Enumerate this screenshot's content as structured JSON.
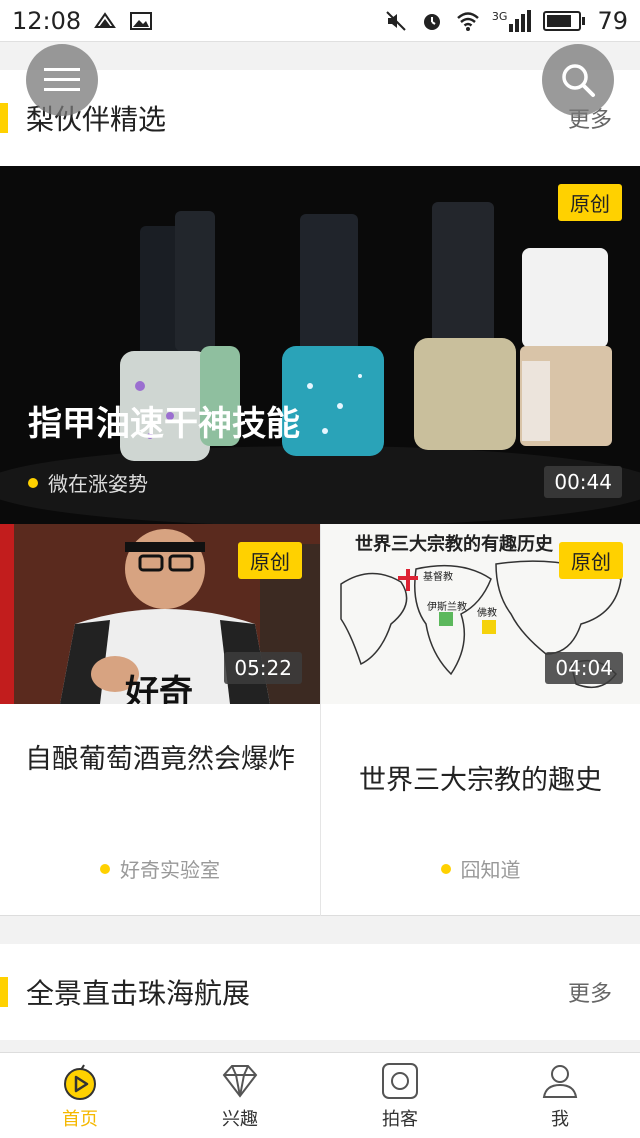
{
  "status_bar": {
    "time": "12:08",
    "network": "3G",
    "battery": "79"
  },
  "header": {
    "menu_icon": "hamburger-icon",
    "search_icon": "search-icon"
  },
  "section1": {
    "title": "梨伙伴精选",
    "more": "更多"
  },
  "feature": {
    "badge": "原创",
    "title": "指甲油速干神技能",
    "author": "微在涨姿势",
    "duration": "00:44"
  },
  "cards": [
    {
      "badge": "原创",
      "duration": "05:22",
      "title": "自酿葡萄酒竟然会爆炸",
      "author": "好奇实验室"
    },
    {
      "badge": "原创",
      "duration": "04:04",
      "title": "世界三大宗教的趣史",
      "author": "囧知道",
      "thumb_text": {
        "heading": "世界三大宗教的有趣历史",
        "label1": "基督教",
        "label2": "伊斯兰教",
        "label3": "佛教"
      }
    }
  ],
  "section2": {
    "title": "全景直击珠海航展",
    "more": "更多"
  },
  "bottom_nav": {
    "items": [
      {
        "label": "首页",
        "icon": "home-play-icon",
        "active": true
      },
      {
        "label": "兴趣",
        "icon": "diamond-icon",
        "active": false
      },
      {
        "label": "拍客",
        "icon": "camera-icon",
        "active": false
      },
      {
        "label": "我",
        "icon": "person-icon",
        "active": false
      }
    ]
  },
  "colors": {
    "accent": "#ffd100",
    "active_nav": "#f5b800"
  }
}
